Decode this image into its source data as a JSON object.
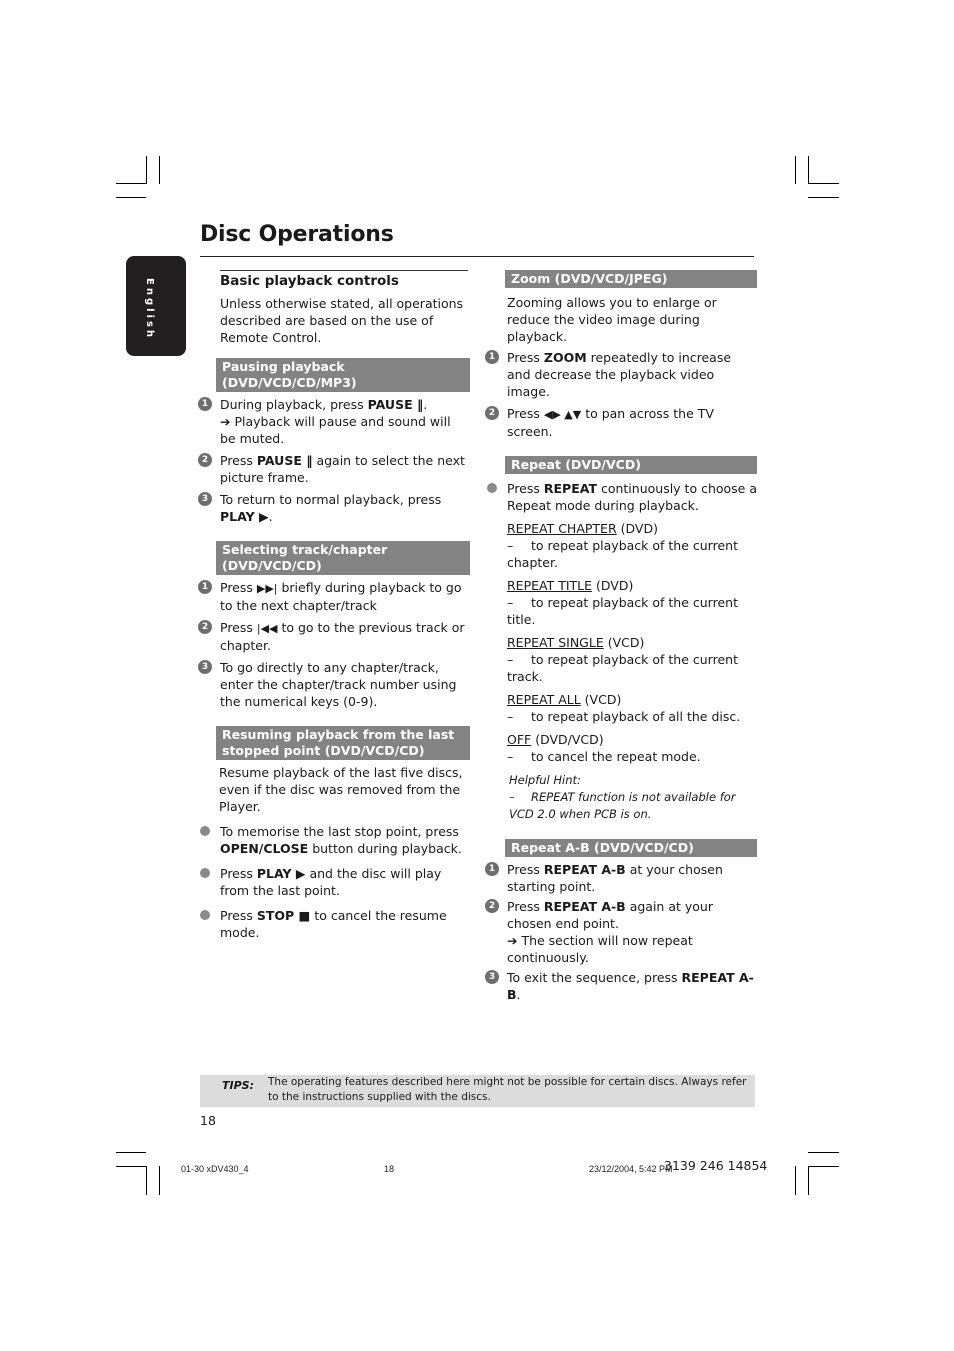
{
  "page": {
    "title": "Disc Operations",
    "language_tab": "English",
    "page_number": "18"
  },
  "basic": {
    "heading": "Basic playback controls",
    "intro": "Unless otherwise stated, all operations described are based on the use of Remote Control."
  },
  "pausing": {
    "heading": "Pausing playback (DVD/VCD/CD/MP3)",
    "steps": [
      {
        "num": "1",
        "pre": "During playback, press ",
        "bold": "PAUSE ‖",
        "post": ".",
        "result": "➔ Playback will pause and sound will be muted."
      },
      {
        "num": "2",
        "pre": "Press ",
        "bold": "PAUSE ‖",
        "post": " again to select the next picture frame."
      },
      {
        "num": "3",
        "pre": "To return to normal playback, press ",
        "bold": "PLAY ▶",
        "post": "."
      }
    ]
  },
  "selecting": {
    "heading": "Selecting track/chapter (DVD/VCD/CD)",
    "steps": [
      {
        "num": "1",
        "pre": "Press ",
        "sym": "▶▶|",
        "post": " briefly during playback to go to the next chapter/track"
      },
      {
        "num": "2",
        "pre": "Press ",
        "sym": "|◀◀",
        "post": " to go to the previous track or chapter."
      },
      {
        "num": "3",
        "text": "To go directly to any chapter/track, enter the chapter/track number using the numerical keys (0-9)."
      }
    ]
  },
  "resuming": {
    "heading": "Resuming playback from the last stopped point (DVD/VCD/CD)",
    "intro": "Resume playback of the last five discs, even if the disc was removed from the Player.",
    "bullets": [
      {
        "pre": "To memorise the last stop point, press ",
        "bold": "OPEN/CLOSE",
        "post": " button during playback."
      },
      {
        "pre": "Press ",
        "bold": "PLAY ▶",
        "post": " and the disc will play from the last point."
      },
      {
        "pre": "Press ",
        "bold": "STOP ■",
        "post": " to cancel the resume mode."
      }
    ]
  },
  "zoom": {
    "heading": "Zoom (DVD/VCD/JPEG)",
    "intro": "Zooming allows you to enlarge or reduce the video image during playback.",
    "steps": [
      {
        "num": "1",
        "pre": "Press ",
        "bold": "ZOOM",
        "post": " repeatedly to increase and decrease the playback video image."
      },
      {
        "num": "2",
        "pre": "Press ",
        "sym": "◀▶ ▲▼",
        "post": " to pan across the TV screen."
      }
    ]
  },
  "repeat": {
    "heading": "Repeat (DVD/VCD)",
    "bullet": {
      "pre": "Press ",
      "bold": "REPEAT",
      "post": " continuously to choose a Repeat mode during playback."
    },
    "options": [
      {
        "name": "REPEAT CHAPTER",
        "disc": " (DVD)",
        "desc": "to repeat playback of the current chapter."
      },
      {
        "name": "REPEAT TITLE",
        "disc": " (DVD)",
        "desc": "to repeat playback of the current title."
      },
      {
        "name": "REPEAT SINGLE",
        "disc": " (VCD)",
        "desc": "to repeat playback of the current track."
      },
      {
        "name": "REPEAT ALL",
        "disc": " (VCD)",
        "desc": "to repeat playback of all the disc."
      },
      {
        "name": "OFF",
        "disc": " (DVD/VCD)",
        "desc": "to cancel the repeat mode."
      }
    ],
    "hint_title": "Helpful Hint:",
    "hint_text": "REPEAT function is not available for VCD 2.0 when PCB is on."
  },
  "repeat_ab": {
    "heading": "Repeat A-B (DVD/VCD/CD)",
    "steps": [
      {
        "num": "1",
        "pre": "Press ",
        "bold": "REPEAT A-B",
        "post": " at your chosen starting point."
      },
      {
        "num": "2",
        "pre": "Press ",
        "bold": "REPEAT A-B",
        "post": " again at your chosen end point.",
        "result": "➔ The section will now repeat continuously."
      },
      {
        "num": "3",
        "pre": "To exit the sequence, press ",
        "bold": "REPEAT A-B",
        "post": "."
      }
    ]
  },
  "tips": {
    "label": "TIPS:",
    "text": "The operating features described here might not be possible for certain discs.  Always refer to the instructions supplied with the discs."
  },
  "footer": {
    "file": "01-30 xDV430_4",
    "page": "18",
    "date": "23/12/2004, 5:42 PM",
    "doc_number": "3139 246 14854"
  }
}
